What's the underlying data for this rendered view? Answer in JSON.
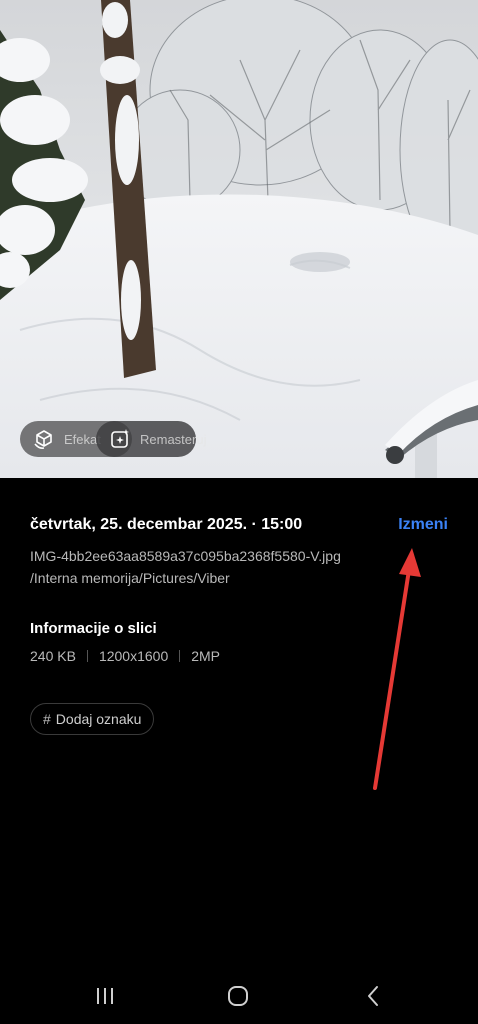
{
  "photo": {
    "effects_label": "Efekat",
    "remaster_label": "Remasteruj",
    "effects_icon": "effects-icon",
    "remaster_icon": "sparkle-icon"
  },
  "details": {
    "date_time": "četvrtak, 25. decembar 2025. · 15:00",
    "edit_label": "Izmeni",
    "file_name": "IMG-4bb2ee63aa8589a37c095ba2368f5580-V.jpg",
    "file_path": "/Interna memorija/Pictures/Viber",
    "info_title": "Informacije o slici",
    "file_size": "240 KB",
    "resolution": "1200x1600",
    "megapixels": "2MP",
    "tag_label": "Dodaj oznaku",
    "tag_icon": "#"
  },
  "colors": {
    "accent": "#3b82f6",
    "annotation_arrow": "#e53935",
    "background": "#000000"
  },
  "navbar": {
    "recent_icon": "recent-apps-icon",
    "home_icon": "home-icon",
    "back_icon": "back-icon"
  }
}
